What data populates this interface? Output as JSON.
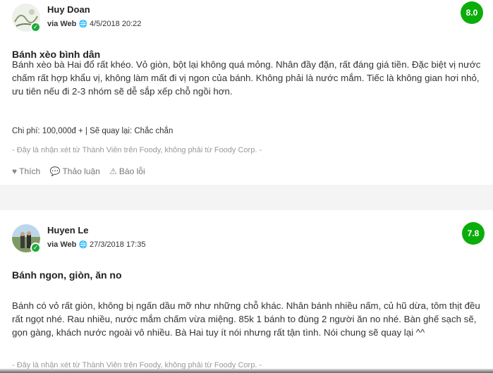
{
  "reviews": [
    {
      "user": "Huy Doan",
      "via": "via Web",
      "datetime": "4/5/2018 20:22",
      "score": "8.0",
      "title": "Bánh xèo bình dân",
      "body": "Bánh xèo bà Hai đổ rất khéo. Vỏ giòn, bột lại không quá mỏng. Nhân đầy đặn, rất đáng giá tiền. Đặc biệt vị nước chấm rất hợp khẩu vị, không làm mất đi vị ngon của bánh. Không phải là nước mắm. Tiếc là không gian hơi nhỏ, ưu tiên nếu đi 2-3 nhóm sẽ dễ sắp xếp chỗ ngồi hơn.",
      "cost_line": "Chi phí: 100,000đ + | Sẽ quay lại: Chắc chắn",
      "disclaimer": "- Đây là nhận xét từ Thành Viên trên Foody, không phải từ Foody Corp. -",
      "actions": {
        "like": "Thích",
        "discuss": "Thảo luận",
        "report": "Báo lỗi"
      }
    },
    {
      "user": "Huyen Le",
      "via": "via Web",
      "datetime": "27/3/2018 17:35",
      "score": "7.8",
      "title": "Bánh ngon, giòn, ăn no",
      "body": "Bánh có vỏ rất giòn, không bị ngấn dầu mỡ như những chỗ khác. Nhân bánh nhiều nấm, củ hũ dừa, tôm thịt đều rất ngọt nhé. Rau nhiều, nước mắm chấm vừa miệng. 85k 1 bánh to đùng 2 người ăn no nhé. Bàn ghế sạch sẽ, gọn gàng, khách nước ngoài vô nhiều. Bà Hai tuy ít nói nhưng rất tận tình. Nói chung sẽ quay lại ^^",
      "disclaimer": "- Đây là nhận xét từ Thành Viên trên Foody, không phải từ Foody Corp. -"
    }
  ],
  "colors": {
    "score_green": "#0bad0b",
    "verified_green": "#1da83a"
  }
}
